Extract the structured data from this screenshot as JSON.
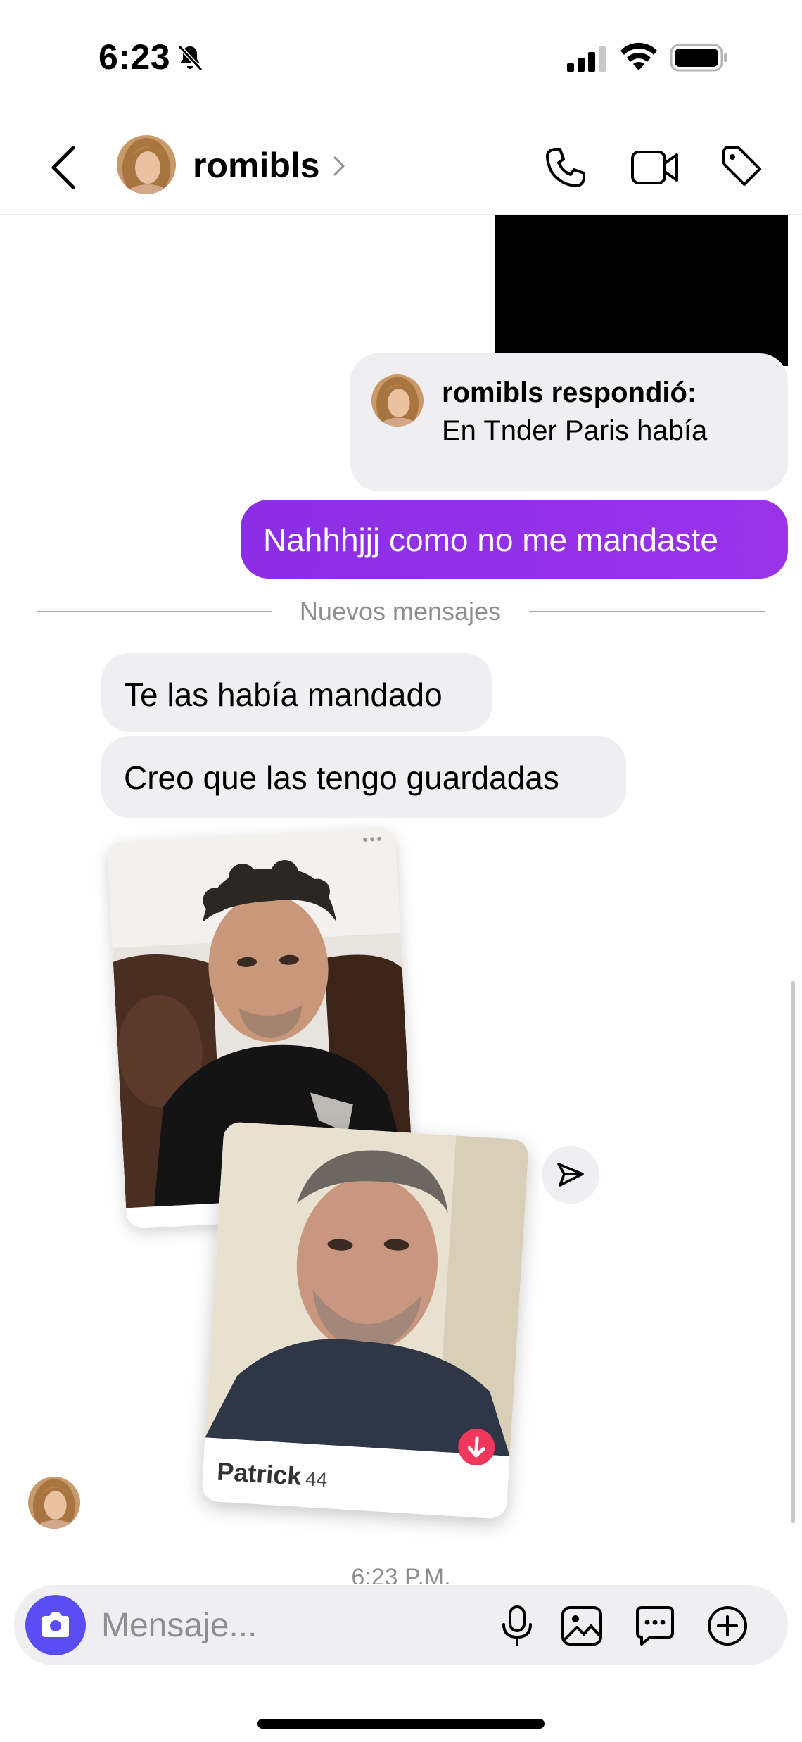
{
  "status_bar": {
    "time": "6:23",
    "icons": [
      "bell-slash-icon",
      "signal-icon",
      "wifi-icon",
      "battery-icon"
    ]
  },
  "header": {
    "username": "romibls",
    "icons": [
      "back-icon",
      "chevron-right-icon",
      "phone-icon",
      "video-icon",
      "tag-icon"
    ]
  },
  "messages": {
    "reply": {
      "title": "romibls respondió:",
      "text": "En Tnder Paris había"
    },
    "sent": "Nahhhjjj como no me mandaste",
    "divider": "Nuevos mensajes",
    "received": [
      "Te las había mandado",
      "Creo que las tengo guardadas"
    ],
    "profile_card": {
      "name": "Patrick",
      "age": "44"
    },
    "timestamp": "6:23 P.M."
  },
  "composer": {
    "placeholder": "Mensaje...",
    "icons": [
      "camera-icon",
      "mic-icon",
      "gallery-icon",
      "sticker-icon",
      "plus-icon"
    ]
  },
  "colors": {
    "sent_bubble": "#8b2ee6",
    "received_bubble": "#efeff2",
    "camera_button": "#5b4df5",
    "badge": "#f0365a"
  }
}
